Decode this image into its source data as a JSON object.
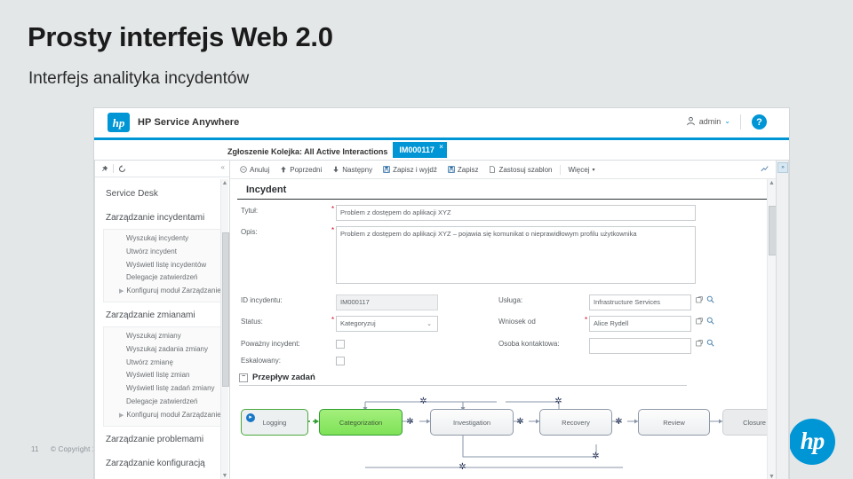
{
  "slide": {
    "title": "Prosty interfejs Web 2.0",
    "subtitle": "Interfejs analityka incydentów",
    "page_number": "11",
    "copyright": "© Copyright 20"
  },
  "app": {
    "brand": "HP Service Anywhere",
    "logo_text": "hp",
    "user": "admin",
    "user_caret": "⌄",
    "help": "?"
  },
  "tabs": {
    "queue_label": "Zgłoszenie Kolejka: All Active Interactions",
    "active_tab": "IM000117",
    "close": "×"
  },
  "nav": {
    "pin_icon": "pin-icon",
    "refresh_icon": "refresh-icon",
    "collapse": "«",
    "scroll_up": "▲",
    "scroll_down": "▼",
    "sections": [
      {
        "head": "Service Desk",
        "items": []
      },
      {
        "head": "Zarządzanie incydentami",
        "items": [
          "Wyszukaj incydenty",
          "Utwórz incydent",
          "Wyświetl listę incydentów",
          "Delegacje zatwierdzeń"
        ],
        "expandable": "Konfiguruj moduł Zarządzanie ..."
      },
      {
        "head": "Zarządzanie zmianami",
        "items": [
          "Wyszukaj zmiany",
          "Wyszukaj zadania zmiany",
          "Utwórz zmianę",
          "Wyświetl listę zmian",
          "Wyświetl listę zadań zmiany",
          "Delegacje zatwierdzeń"
        ],
        "expandable": "Konfiguruj moduł Zarządzanie ..."
      },
      {
        "head": "Zarządzanie problemami",
        "items": []
      },
      {
        "head": "Zarządzanie konfiguracją",
        "items": []
      }
    ]
  },
  "toolbar": {
    "cancel": "Anuluj",
    "previous": "Poprzedni",
    "next": "Następny",
    "save_exit": "Zapisz i wyjdź",
    "save": "Zapisz",
    "apply_template": "Zastosuj szablon",
    "more": "Więcej",
    "more_caret": "▾"
  },
  "form": {
    "section_title": "Incydent",
    "title_label": "Tytuł:",
    "title_value": "Problem z dostępem do aplikacji XYZ",
    "desc_label": "Opis:",
    "desc_value": "Problem z dostępem do aplikacji XYZ – pojawia się komunikat o nieprawidłowym profilu użytkownika",
    "id_label": "ID incydentu:",
    "id_value": "IM000117",
    "status_label": "Status:",
    "status_value": "Kategoryzuj",
    "major_label": "Poważny incydent:",
    "escalated_label": "Eskalowany:",
    "service_label": "Usługa:",
    "service_value": "Infrastructure Services",
    "requested_by_label": "Wniosek od",
    "requested_by_value": "Alice Rydell",
    "contact_label": "Osoba kontaktowa:",
    "contact_value": "",
    "required_mark": "*"
  },
  "workflow": {
    "title": "Przepływ zadań",
    "collapse_mark": "−",
    "nodes": [
      {
        "label": "Logging",
        "state": "done"
      },
      {
        "label": "Categorization",
        "state": "active"
      },
      {
        "label": "Investigation",
        "state": "pending"
      },
      {
        "label": "Recovery",
        "state": "pending"
      },
      {
        "label": "Review",
        "state": "pending"
      },
      {
        "label": "Closure",
        "state": "disabled"
      }
    ],
    "gear_icon": "gear-icon"
  },
  "colors": {
    "accent": "#0096d6",
    "active_node": "#7fe257",
    "required": "#d0021b",
    "slide_bg": "#e3e7e8"
  }
}
